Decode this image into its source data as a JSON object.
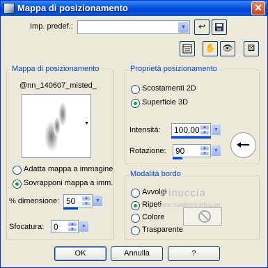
{
  "window": {
    "title": "Mappa di posizionamento",
    "close_glyph": "✕"
  },
  "preset": {
    "label": "Imp. predef.:",
    "value": ""
  },
  "icons": {
    "reset": "reset-arrow-icon",
    "save": "save-icon",
    "layout": "layout-icon",
    "hand_view": "hand-view-icon",
    "eye_view": "eye-view-icon",
    "random": "dice-icon"
  },
  "map_group": {
    "title": "Mappa di posizionamento",
    "map_name": "@nn_140607_misted_",
    "option_fit": "Adatta mappa a immagine",
    "option_tile": "Sovrapponi mappa a imm.",
    "dimension_label": "% dimensione:",
    "dimension_value": "50",
    "blur_label": "Sfocatura:",
    "blur_value": "0"
  },
  "props_group": {
    "title": "Proprietà posizionamento",
    "option_2d": "Scostamenti 2D",
    "option_3d": "Superficie 3D",
    "intensity_label": "Intensità:",
    "intensity_value": "100,00",
    "rotation_label": "Rotazione:",
    "rotation_value": "90"
  },
  "edge_group": {
    "title": "Modalità bordo",
    "option_wrap": "Avvolgi",
    "option_repeat": "Ripeti",
    "option_color": "Colore",
    "option_transparent": "Trasparente"
  },
  "watermark": {
    "name": "Pinuccia",
    "url": "www.maidiregrafica.eu"
  },
  "buttons": {
    "ok": "OK",
    "cancel": "Annulla",
    "help": "?"
  }
}
